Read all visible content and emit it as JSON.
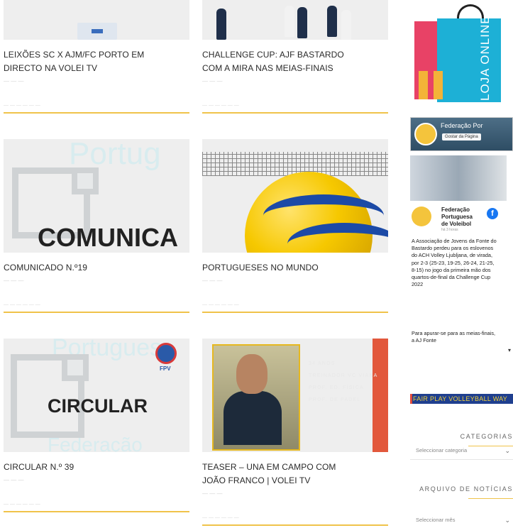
{
  "articles": [
    {
      "title_l1": "LEIXÕES SC x AJM/FC PORTO EM",
      "title_l2": "DIRECTO NA VOLEI TV"
    },
    {
      "title_l1": "CHALLENGE CUP: AJF BASTARDO",
      "title_l2": "COM A MIRA NAS MEIAS-FINAIS"
    },
    {
      "title_l1": "COMUNICADO N.º19",
      "title_l2": "",
      "thumb_word": "COMUNICA",
      "thumb_bg": "Portug"
    },
    {
      "title_l1": "PORTUGUESES NO MUNDO",
      "title_l2": ""
    },
    {
      "title_l1": "CIRCULAR N.º 39",
      "title_l2": "",
      "thumb_word": "CIRCULAR",
      "thumb_bg": "Portugues",
      "thumb_bg2": "Federação",
      "badge": "FPV"
    },
    {
      "title_l1": "TEASER – UNA EM CAMPO COM",
      "title_l2": "JOÃO FRANCO | VOLEI TV",
      "teaser_lines": [
        "34 ANOS",
        "TREINADOR VC VIANA",
        "PROF. ED. FÍSICA",
        "PROF. DE PADEL"
      ]
    }
  ],
  "sidebar": {
    "shop_label": "LOJA ONLINE",
    "facebook": {
      "page_name": "Federação Por",
      "like_button": "Gostar da Página",
      "author_l1": "Federação",
      "author_l2": "Portuguesa",
      "author_l3": "de Voleibol",
      "time": "há 3 horas",
      "post": "A Associação de Jovens da Fonte do Bastardo perdeu para os eslovenos do ACH Volley Ljubljana, de virada, por 2-3 (25-23, 19-25, 26-24, 21-25, 8-15) no jogo da primeira mão dos quartos-de-final da Challenge Cup 2022",
      "post_more": "Para apurar-se para as meias-finais, a AJ Fonte"
    },
    "fairplay": "FAIR PLAY VOLLEYBALL WAY",
    "categories_title": "CATEGORIAS",
    "categories_select": "Seleccionar categoria",
    "archive_title": "ARQUIVO DE NOTÍCIAS",
    "archive_select": "Seleccionar mês"
  },
  "colors": {
    "accent": "#f0c34a",
    "facebook": "#1877f2",
    "fairplay_bg": "#1f3f8f"
  }
}
